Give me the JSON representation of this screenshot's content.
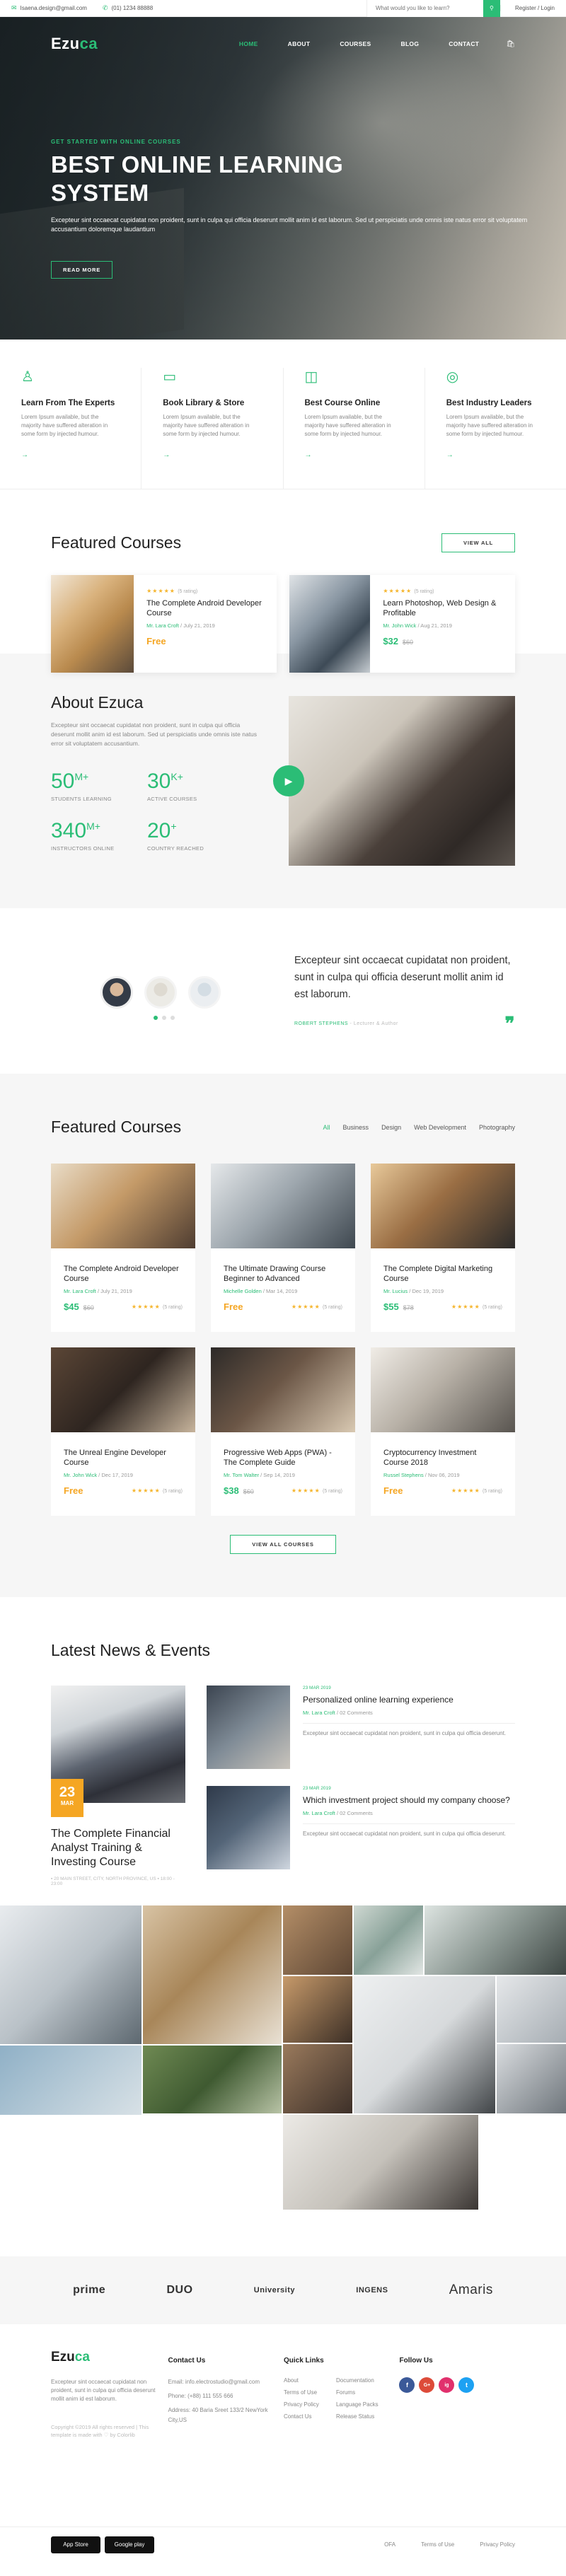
{
  "topbar": {
    "email": "Isaena.design@gmail.com",
    "phone": "(01) 1234 88888",
    "search_placeholder": "What would you like to learn?",
    "login": "Register / Login"
  },
  "nav": {
    "logo_main": "Ezu",
    "logo_accent": "ca",
    "items": [
      "HOME",
      "ABOUT",
      "COURSES",
      "BLOG",
      "CONTACT"
    ]
  },
  "hero": {
    "kicker": "GET STARTED WITH ONLINE COURSES",
    "title": "BEST ONLINE LEARNING SYSTEM",
    "description": "Excepteur sint occaecat cupidatat non proident, sunt in culpa qui officia deserunt mollit anim id est laborum. Sed ut perspiciatis unde omnis iste natus error sit voluptatem accusantium doloremque laudantium",
    "button": "READ MORE"
  },
  "features": [
    {
      "title": "Learn From The Experts",
      "desc": "Lorem Ipsum available, but the majority have suffered alteration in some form by injected humour.",
      "icon": "user-icon"
    },
    {
      "title": "Book Library & Store",
      "desc": "Lorem Ipsum available, but the majority have suffered alteration in some form by injected humour.",
      "icon": "folder-icon"
    },
    {
      "title": "Best Course Online",
      "desc": "Lorem Ipsum available, but the majority have suffered alteration in some form by injected humour.",
      "icon": "book-icon"
    },
    {
      "title": "Best Industry Leaders",
      "desc": "Lorem Ipsum available, but the majority have suffered alteration in some form by injected humour.",
      "icon": "globe-icon"
    }
  ],
  "featured1": {
    "title": "Featured Courses",
    "button": "VIEW ALL",
    "reviews": "(5 rating)",
    "courses": [
      {
        "title": "The Complete Android Developer Course",
        "author": "Mr. Lara Croft",
        "date": "July 21, 2019",
        "price": "Free",
        "old": ""
      },
      {
        "title": "Learn Photoshop, Web Design & Profitable",
        "author": "Mr. John Wick",
        "date": "Aug 21, 2019",
        "price": "$32",
        "old": "$60"
      }
    ]
  },
  "about": {
    "title": "About Ezuca",
    "desc": "Excepteur sint occaecat cupidatat non proident, sunt in culpa qui officia deserunt mollit anim id est laborum. Sed ut perspiciatis unde omnis iste natus error sit voluptatem accusantium.",
    "stats": [
      {
        "num": "50",
        "suffix": "M+",
        "label": "STUDENTS LEARNING"
      },
      {
        "num": "30",
        "suffix": "K+",
        "label": "ACTIVE COURSES"
      },
      {
        "num": "340",
        "suffix": "M+",
        "label": "INSTRUCTORS ONLINE"
      },
      {
        "num": "20",
        "suffix": "+",
        "label": "COUNTRY REACHED"
      }
    ]
  },
  "testimonial": {
    "quote": "Excepteur sint occaecat cupidatat non proident, sunt in culpa qui officia deserunt mollit anim id est laborum.",
    "author": "ROBERT STEPHENS",
    "role": "Lecturer & Author"
  },
  "featured2": {
    "title": "Featured Courses",
    "tabs": [
      "All",
      "Business",
      "Design",
      "Web Development",
      "Photography"
    ],
    "reviews": "(5 rating)",
    "button": "VIEW ALL COURSES",
    "courses": [
      {
        "title": "The Complete Android Developer Course",
        "author": "Mr. Lara Croft",
        "date": "July 21, 2019",
        "price": "$45",
        "old": "$60"
      },
      {
        "title": "The Ultimate Drawing Course Beginner to Advanced",
        "author": "Michelle Golden",
        "date": "Mar 14, 2019",
        "price": "Free",
        "old": ""
      },
      {
        "title": "The Complete Digital Marketing Course",
        "author": "Mr. Lucius",
        "date": "Dec 19, 2019",
        "price": "$55",
        "old": "$78"
      },
      {
        "title": "The Unreal Engine Developer Course",
        "author": "Mr. John Wick",
        "date": "Dec 17, 2019",
        "price": "Free",
        "old": ""
      },
      {
        "title": "Progressive Web Apps (PWA) - The Complete Guide",
        "author": "Mr. Tom Walter",
        "date": "Sep 14, 2019",
        "price": "$38",
        "old": "$60"
      },
      {
        "title": "Cryptocurrency Investment Course 2018",
        "author": "Russel Stephens",
        "date": "Nov 06, 2019",
        "price": "Free",
        "old": ""
      }
    ]
  },
  "news": {
    "title": "Latest News & Events",
    "big": {
      "day": "23",
      "month": "MAR",
      "title": "The Complete Financial Analyst Training & Investing Course",
      "meta": "▪ 20 MAIN STREET, CITY, NORTH PROVINCE, US   ▪ 18:00 - 23:00"
    },
    "items": [
      {
        "date": "23 MAR 2019",
        "title": "Personalized online learning experience",
        "author": "Mr. Lara Croft",
        "comments": "02 Comments",
        "excerpt": "Excepteur sint occaecat cupidatat non proident, sunt in culpa qui officia deserunt."
      },
      {
        "date": "23 MAR 2019",
        "title": "Which investment project should my company choose?",
        "author": "Mr. Lara Croft",
        "comments": "02 Comments",
        "excerpt": "Excepteur sint occaecat cupidatat non proident, sunt in culpa qui officia deserunt."
      }
    ]
  },
  "partners": [
    "prime",
    "DUO",
    "University",
    "INGENS",
    "Amaris"
  ],
  "footer": {
    "logo_main": "Ezu",
    "logo_accent": "ca",
    "desc": "Excepteur sint occaecat cupidatat non proident, sunt in culpa qui officia deserunt mollit anim id est laborum.",
    "copyright": "Copyright ©2019 All rights reserved | This template is made with ♡ by Colorlib",
    "contact_title": "Contact Us",
    "contact": [
      "Email: info.electrostudio@gmail.com",
      "Phone: (+88) 111 555 666",
      "Address: 40 Baria Sreet 133/2 NewYork City,US"
    ],
    "links_title": "Quick Links",
    "links": [
      "About",
      "Documentation",
      "Terms of Use",
      "Forums",
      "Privacy Policy",
      "Language Packs",
      "Contact Us",
      "Release Status"
    ],
    "follow_title": "Follow Us",
    "social": [
      "f",
      "G+",
      "ig",
      "t"
    ],
    "stores": [
      "App Store",
      "Google play"
    ],
    "bottom_links": [
      "OFA",
      "Terms of Use",
      "Privacy Policy"
    ]
  }
}
